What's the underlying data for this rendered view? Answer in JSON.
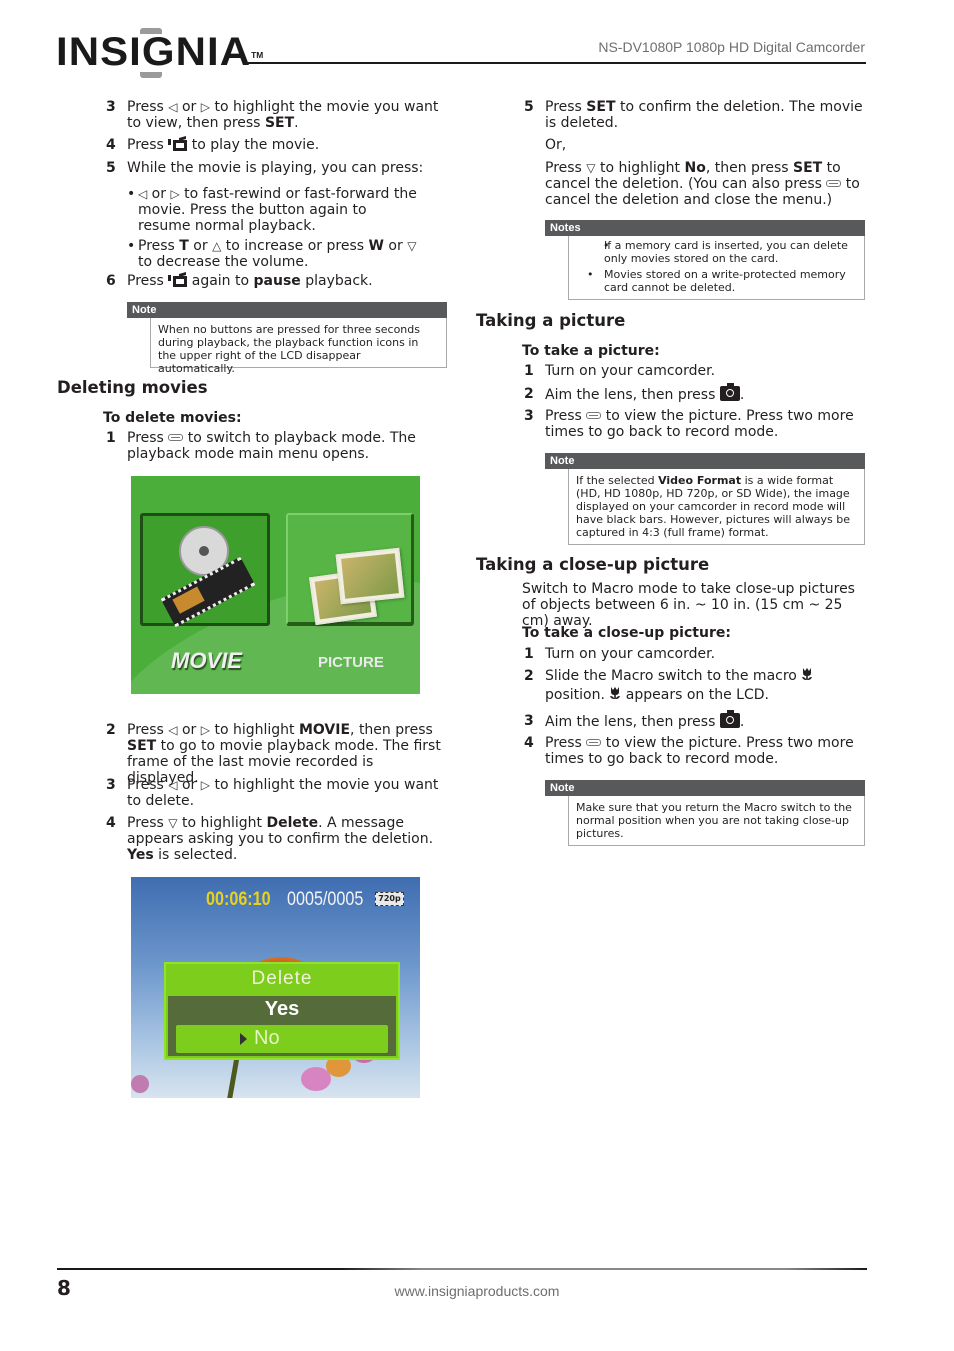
{
  "header": {
    "brand": "INSIGNIA",
    "trademark": "TM",
    "doc_title": "NS-DV1080P 1080p HD Digital Camcorder"
  },
  "left_column": {
    "playback_steps": [
      {
        "num": "3",
        "text_a": "Press ",
        "icon1": "left-arrow",
        "text_b": " or ",
        "icon2": "right-arrow",
        "text_c": " to highlight the movie you want to view, then press ",
        "bold": "SET",
        "text_d": "."
      },
      {
        "num": "4",
        "text_a": "Press ",
        "icon": "play-pause",
        "text_b": " to play the movie."
      },
      {
        "num": "5",
        "text": "While the movie is playing, you can press:"
      },
      {
        "num": "6",
        "text_a": "Press ",
        "icon": "play-pause",
        "text_b": " again to ",
        "bold": "pause",
        "text_c": " playback."
      }
    ],
    "bullets": [
      {
        "text_a": " or ",
        "text_b": " to fast-rewind or fast-forward the movie. Press the button again to resume normal playback."
      },
      {
        "text_a": "Press ",
        "bold1": "T",
        "text_b": " or ",
        "text_c": " to increase or press ",
        "bold2": "W",
        "text_d": " or ",
        "text_e": "  to decrease the volume."
      }
    ],
    "note1": {
      "label": "Note",
      "text": "When no buttons are pressed for three seconds during playback, the playback function icons in the upper right of the LCD disappear automatically."
    },
    "section_deleting": {
      "heading": "Deleting movies",
      "procedure": "To delete movies:",
      "step1": {
        "num": "1",
        "text_a": "Press ",
        "text_b": " to switch to playback mode. The playback mode main menu opens."
      },
      "step2": {
        "num": "2",
        "text_a": "Press ",
        "text_b": " or ",
        "text_c": " to highlight ",
        "bold1": "MOVIE",
        "text_d": ", then press ",
        "bold2": "SET",
        "text_e": " to go to movie playback mode. The first frame of the last movie recorded is displayed."
      },
      "step3": {
        "num": "3",
        "text_a": "Press ",
        "text_b": " or ",
        "text_c": " to highlight the movie you want to delete."
      },
      "step4": {
        "num": "4",
        "text_a": "Press ",
        "text_b": " to highlight ",
        "bold1": "Delete",
        "text_c": ". A message appears asking you to confirm the deletion. ",
        "bold2": "Yes",
        "text_d": " is selected."
      }
    },
    "screen_playback_menu": {
      "option_movie": "MOVIE",
      "option_picture": "PICTURE",
      "selected": "MOVIE",
      "bg_color": "#4cae3a"
    },
    "screen_delete": {
      "timecode": "00:06:10",
      "counter": "0005/0005",
      "resolution": "720p",
      "dialog_title": "Delete",
      "option_yes": "Yes",
      "option_no": "No",
      "highlighted": "No",
      "accent_color": "#7ccd1c"
    }
  },
  "right_column": {
    "step5": {
      "num": "5",
      "text_a": "Press ",
      "bold": "SET",
      "text_b": " to confirm the deletion. The movie is deleted."
    },
    "or": "Or,",
    "alt": {
      "text_a": "Press ",
      "text_b": " to highlight ",
      "bold1": "No",
      "text_c": ", then press ",
      "bold2": "SET",
      "text_d": " to cancel the deletion. (You can also press ",
      "text_e": " to cancel the deletion and close the menu.)"
    },
    "notes": {
      "label": "Notes",
      "items": [
        "If a memory card is inserted, you can delete only movies stored on the card.",
        "Movies stored on a write-protected memory card cannot be deleted."
      ]
    },
    "section_picture": {
      "heading": "Taking a picture",
      "procedure": "To take a picture:",
      "steps": [
        {
          "num": "1",
          "text": "Turn on your camcorder."
        },
        {
          "num": "2",
          "text_a": "Aim the lens, then press ",
          "text_b": "."
        },
        {
          "num": "3",
          "text_a": "Press ",
          "text_b": " to view the picture. Press two more times to go back to record mode."
        }
      ],
      "note": {
        "label": "Note",
        "text_a": "If the selected ",
        "bold": "Video Format",
        "text_b": " is a wide format (HD, HD 1080p, HD 720p, or SD Wide), the image displayed on your camcorder in record mode will have black bars. However, pictures will always be captured in 4:3 (full frame) format."
      }
    },
    "section_closeup": {
      "heading": "Taking a close-up picture",
      "intro": "Switch to Macro mode to take close-up pictures of objects between 6 in. ~ 10 in. (15 cm ~ 25 cm) away.",
      "procedure": "To take a close-up picture:",
      "steps": [
        {
          "num": "1",
          "text": "Turn on your camcorder."
        },
        {
          "num": "2",
          "text_a": "Slide the Macro switch to the macro ",
          "text_b": " position. ",
          "text_c": " appears on the LCD."
        },
        {
          "num": "3",
          "text_a": "Aim the lens, then press ",
          "text_b": "."
        },
        {
          "num": "4",
          "text_a": "Press ",
          "text_b": " to view the picture. Press two more times to go back to record mode."
        }
      ],
      "note": {
        "label": "Note",
        "text": "Make sure that you return the Macro switch to the normal position when you are not taking close-up pictures."
      }
    }
  },
  "footer": {
    "page_number": "8",
    "url": "www.insigniaproducts.com"
  }
}
